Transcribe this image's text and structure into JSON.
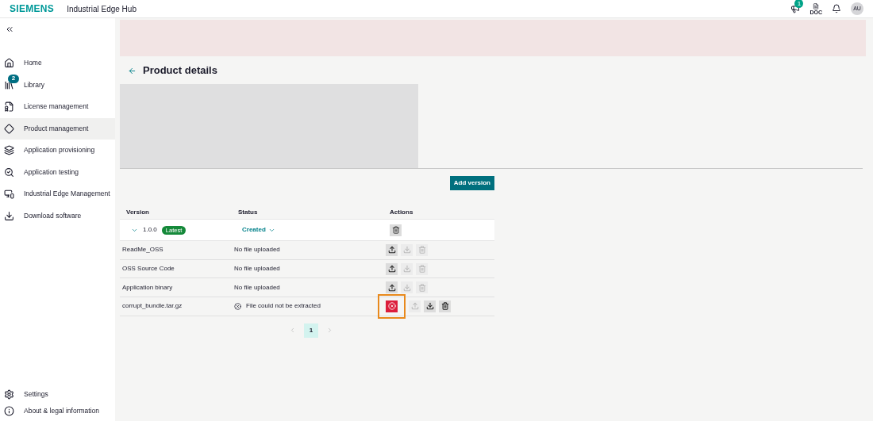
{
  "header": {
    "logo": "SIEMENS",
    "app_title": "Industrial Edge Hub",
    "notification_badge": "1",
    "doc_label": "DOC",
    "avatar": "AU"
  },
  "sidebar": {
    "items": [
      {
        "label": "Home",
        "selected": false
      },
      {
        "label": "Library",
        "selected": false,
        "badge": "2"
      },
      {
        "label": "License management",
        "selected": false
      },
      {
        "label": "Product management",
        "selected": true
      },
      {
        "label": "Application provisioning",
        "selected": false
      },
      {
        "label": "Application testing",
        "selected": false
      },
      {
        "label": "Industrial Edge Management",
        "selected": false
      },
      {
        "label": "Download software",
        "selected": false
      }
    ],
    "bottom_items": [
      {
        "label": "Settings"
      },
      {
        "label": "About & legal information"
      }
    ]
  },
  "page": {
    "title": "Product details",
    "add_button": "Add version"
  },
  "table": {
    "columns": [
      "Version",
      "Status",
      "Actions"
    ],
    "version_row": {
      "version": "1.0.0",
      "badge": "Latest",
      "status": "Created",
      "expanded": true
    },
    "rows": [
      {
        "name": "ReadMe_OSS",
        "status": "No file uploaded",
        "error": false,
        "actions": [
          {
            "kind": "upload",
            "disabled": false
          },
          {
            "kind": "download",
            "disabled": true
          },
          {
            "kind": "delete",
            "disabled": true
          }
        ]
      },
      {
        "name": "OSS Source Code",
        "status": "No file uploaded",
        "error": false,
        "actions": [
          {
            "kind": "upload",
            "disabled": false
          },
          {
            "kind": "download",
            "disabled": true
          },
          {
            "kind": "delete",
            "disabled": true
          }
        ]
      },
      {
        "name": "Application binary",
        "status": "No file uploaded",
        "error": false,
        "actions": [
          {
            "kind": "upload",
            "disabled": false
          },
          {
            "kind": "download",
            "disabled": true
          },
          {
            "kind": "delete",
            "disabled": true
          }
        ]
      },
      {
        "name": "corrupt_bundle.tar.gz",
        "status": "File could not be extracted",
        "error": true,
        "actions": [
          {
            "kind": "error",
            "disabled": false,
            "highlighted": true
          },
          {
            "kind": "upload",
            "disabled": true
          },
          {
            "kind": "download",
            "disabled": false
          },
          {
            "kind": "delete",
            "disabled": false
          }
        ]
      }
    ]
  },
  "pagination": {
    "pages": [
      {
        "label": "1",
        "selected": true
      }
    ]
  }
}
